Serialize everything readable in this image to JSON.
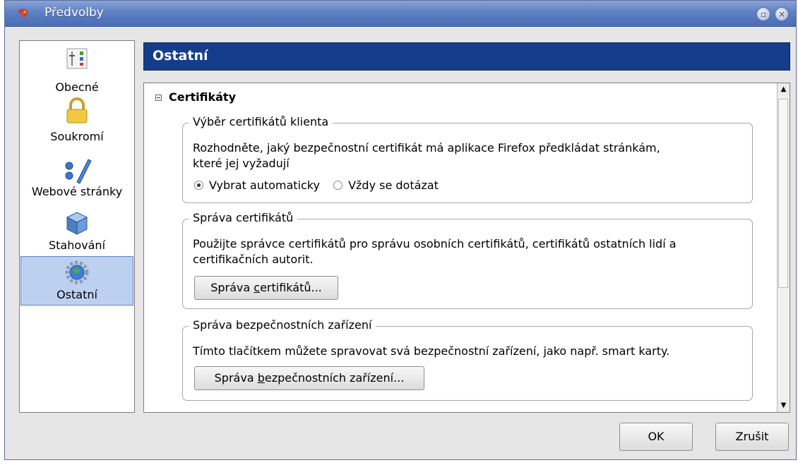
{
  "window": {
    "title": "Předvolby"
  },
  "sidebar": {
    "items": [
      {
        "label": "Obecné",
        "icon": "general-settings-icon"
      },
      {
        "label": "Soukromí",
        "icon": "padlock-icon"
      },
      {
        "label": "Webové stránky",
        "icon": "web-features-icon"
      },
      {
        "label": "Stahování",
        "icon": "downloads-box-icon"
      },
      {
        "label": "Ostatní",
        "icon": "advanced-gear-globe-icon",
        "selected": true
      }
    ]
  },
  "header": {
    "title": "Ostatní"
  },
  "content": {
    "section_title": "Certifikáty",
    "client_cert": {
      "legend": "Výběr certifikátů klienta",
      "desc_line1": "Rozhodněte, jaký bezpečnostní certifikát má aplikace Firefox předkládat stránkám,",
      "desc_line2": "které jej vyžadují",
      "options": [
        {
          "label": "Vybrat automaticky",
          "checked": true
        },
        {
          "label": "Vždy se dotázat",
          "checked": false
        }
      ]
    },
    "cert_mgmt": {
      "legend": "Správa certifikátů",
      "desc_line1": "Použijte správce certifikátů pro správu osobních certifikátů, certifikátů ostatních lidí a",
      "desc_line2": "certifikačních autorit.",
      "button_pre": "Správa ",
      "button_accel": "c",
      "button_post": "ertifikátů..."
    },
    "device_mgmt": {
      "legend": "Správa bezpečnostních zařízení",
      "desc": "Tímto tlačítkem můžete spravovat svá bezpečnostní zařízení, jako např. smart karty.",
      "button_pre": "Správa ",
      "button_accel": "b",
      "button_post": "ezpečnostních zařízení..."
    }
  },
  "footer": {
    "ok_label": "OK",
    "cancel_label": "Zrušit"
  },
  "colors": {
    "titlebar": "#5d7fc3",
    "header": "#153d8b",
    "selection": "#bcd0f0"
  }
}
